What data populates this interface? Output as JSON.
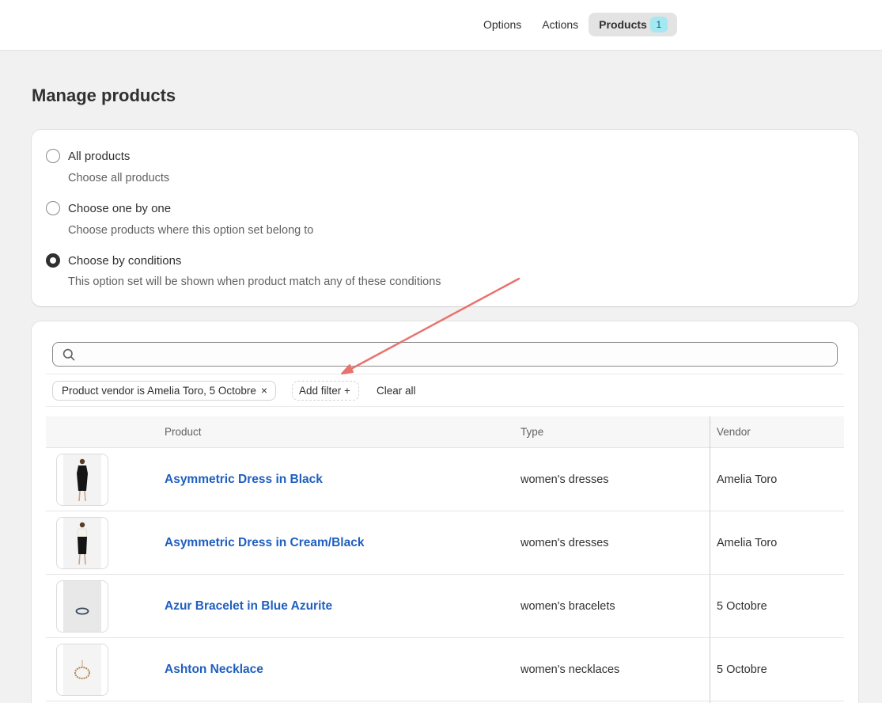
{
  "topnav": {
    "options_label": "Options",
    "actions_label": "Actions",
    "products_label": "Products",
    "products_count": "1"
  },
  "page": {
    "title": "Manage products"
  },
  "selection": {
    "options": [
      {
        "label": "All products",
        "help": "Choose all products",
        "checked": false
      },
      {
        "label": "Choose one by one",
        "help": "Choose products where this option set belong to",
        "checked": false
      },
      {
        "label": "Choose by conditions",
        "help": "This option set will be shown when product match any of these conditions",
        "checked": true
      }
    ]
  },
  "search": {
    "placeholder": "",
    "value": ""
  },
  "filters": {
    "applied_label": "Product vendor is Amelia Toro, 5 Octobre",
    "remove_glyph": "×",
    "add_label": "Add filter +",
    "clear_label": "Clear all"
  },
  "table": {
    "headers": {
      "product": "Product",
      "type": "Type",
      "vendor": "Vendor"
    },
    "rows": [
      {
        "name": "Asymmetric Dress in Black",
        "type": "women's dresses",
        "vendor": "Amelia Toro",
        "thumb": "dress-black"
      },
      {
        "name": "Asymmetric Dress in Cream/Black",
        "type": "women's dresses",
        "vendor": "Amelia Toro",
        "thumb": "dress-cream"
      },
      {
        "name": "Azur Bracelet in Blue Azurite",
        "type": "women's bracelets",
        "vendor": "5 Octobre",
        "thumb": "bracelet"
      },
      {
        "name": "Ashton Necklace",
        "type": "women's necklaces",
        "vendor": "5 Octobre",
        "thumb": "necklace"
      }
    ]
  },
  "colors": {
    "link": "#1f5fbf",
    "annotation_arrow": "#e8736e",
    "badge_bg": "#a4e8f2"
  }
}
